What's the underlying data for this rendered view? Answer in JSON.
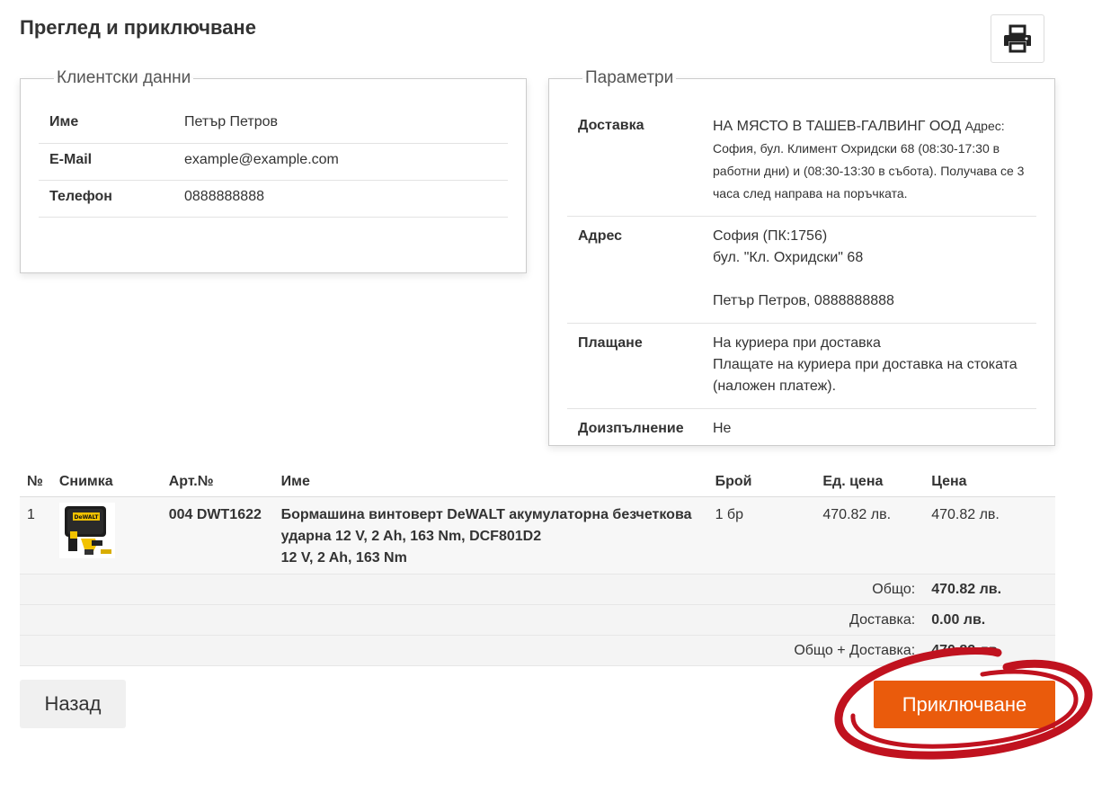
{
  "page": {
    "title": "Преглед и приключване"
  },
  "client": {
    "legend": "Клиентски данни",
    "rows": [
      {
        "label": "Име",
        "value": "Петър Петров"
      },
      {
        "label": "E-Mail",
        "value": "example@example.com"
      },
      {
        "label": "Телефон",
        "value": "0888888888"
      }
    ]
  },
  "params": {
    "legend": "Параметри",
    "delivery": {
      "label": "Доставка",
      "name": "НА МЯСТО В ТАШЕВ-ГАЛВИНГ ООД",
      "details": "Адрес: София, бул. Климент Охридски 68 (08:30-17:30 в работни дни) и (08:30-13:30 в събота). Получава се 3 часа след направа на поръчката."
    },
    "address": {
      "label": "Адрес",
      "line1": "София (ПК:1756)",
      "line2": "бул. \"Кл. Охридски\" 68",
      "line3": "Петър Петров, 0888888888"
    },
    "payment": {
      "label": "Плащане",
      "line1": "На куриера при доставка",
      "line2": "Плащате на куриера при доставка на стоката (наложен платеж)."
    },
    "extra": {
      "label": "Доизпълнение",
      "value": "Не"
    }
  },
  "items": {
    "headers": {
      "no": "№",
      "photo": "Снимка",
      "sku": "Арт.№",
      "name": "Име",
      "qty": "Брой",
      "unit_price": "Ед. цена",
      "price": "Цена"
    },
    "rows": [
      {
        "no": "1",
        "sku": "004 DWT1622",
        "name": "Бормашина винтоверт DeWALT акумулаторна безчеткова ударна 12 V, 2 Ah, 163 Nm, DCF801D2",
        "spec": "12 V, 2 Ah, 163 Nm",
        "qty": "1 бр",
        "unit_price": "470.82 лв.",
        "price": "470.82 лв.",
        "thumb_brand": "DeWALT"
      }
    ],
    "totals": [
      {
        "label": "Общо:",
        "value": "470.82 лв."
      },
      {
        "label": "Доставка:",
        "value": "0.00 лв."
      },
      {
        "label": "Общо + Доставка:",
        "value": "470.82 лв."
      }
    ]
  },
  "actions": {
    "back_label": "Назад",
    "finish_label": "Приключване"
  },
  "colors": {
    "accent": "#ea5b0c",
    "annotation": "#c0121f"
  }
}
